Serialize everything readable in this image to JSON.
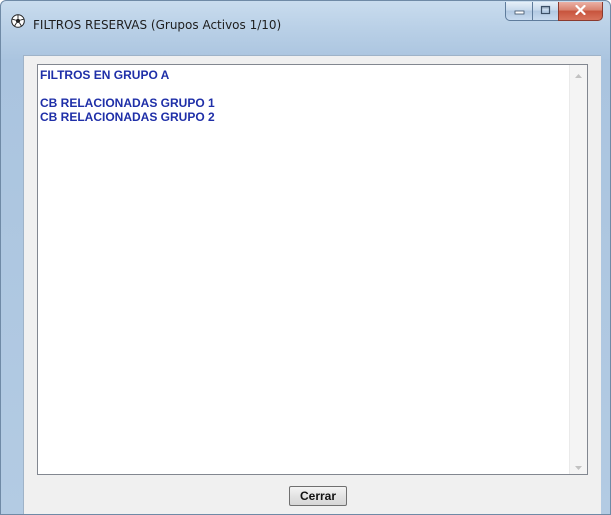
{
  "window": {
    "title": "FILTROS RESERVAS  (Grupos Activos 1/10)",
    "icons": {
      "app": "soccer-ball-icon",
      "minimize": "minimize-icon",
      "maximize": "maximize-icon",
      "close": "close-icon"
    }
  },
  "list": {
    "lines": [
      "FILTROS EN GRUPO A",
      "",
      "CB RELACIONADAS GRUPO 1",
      "CB RELACIONADAS GRUPO 2"
    ],
    "text_color": "#1f2fa8"
  },
  "buttons": {
    "close_label": "Cerrar"
  }
}
